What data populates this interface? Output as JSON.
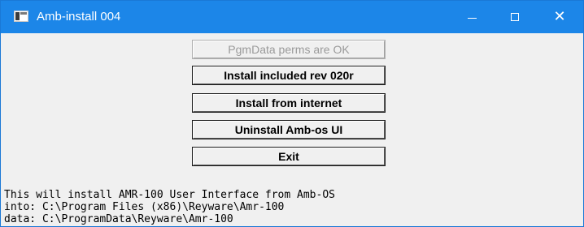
{
  "window": {
    "title": "Amb-install 004",
    "controls": {
      "minimize": "minimize",
      "maximize": "maximize",
      "close": "close"
    }
  },
  "buttons": {
    "perms": "PgmData perms are OK",
    "install_included": "Install included rev 020r",
    "install_internet": "Install from internet",
    "uninstall": "Uninstall Amb-os UI",
    "exit": "Exit"
  },
  "info": {
    "line1": "This will install AMR-100 User Interface from Amb-OS",
    "line2": "into: C:\\Program Files (x86)\\Reyware\\Amr-100",
    "line3": "data: C:\\ProgramData\\Reyware\\Amr-100"
  },
  "colors": {
    "titlebar": "#1c86e8",
    "background": "#f0f0f0",
    "disabled_text": "#9a9a9a"
  },
  "icons": [
    "app-icon",
    "minimize-icon",
    "maximize-icon",
    "close-icon"
  ]
}
